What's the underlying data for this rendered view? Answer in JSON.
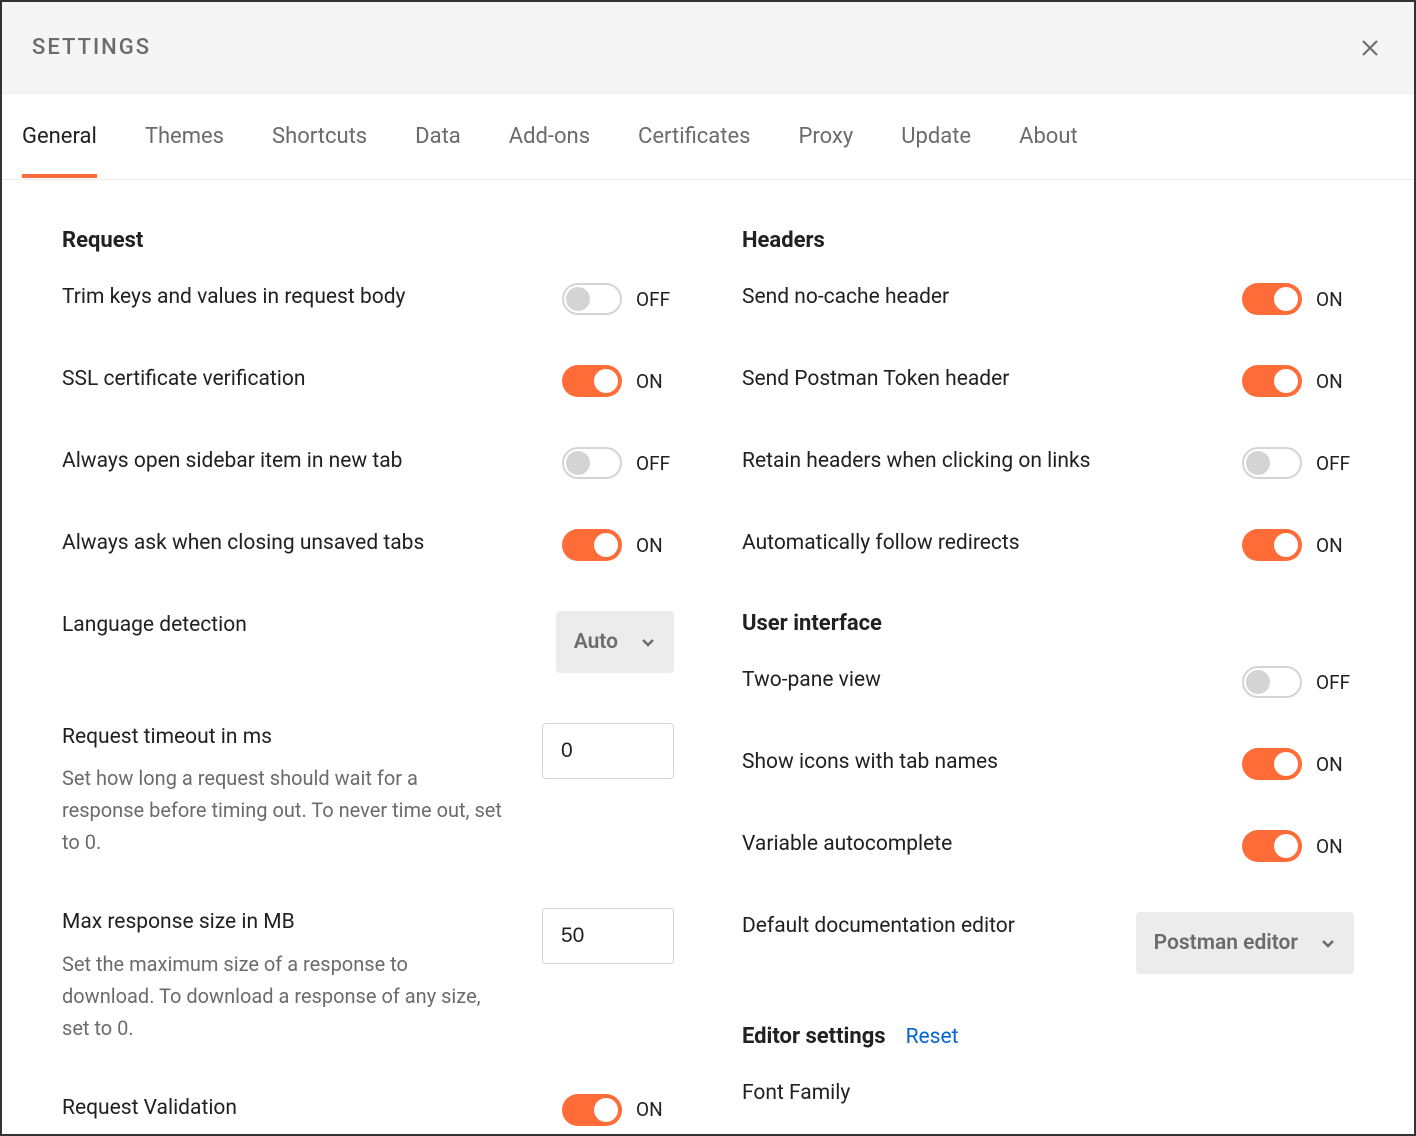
{
  "header": {
    "title": "SETTINGS"
  },
  "tabs": [
    {
      "label": "General",
      "active": true
    },
    {
      "label": "Themes",
      "active": false
    },
    {
      "label": "Shortcuts",
      "active": false
    },
    {
      "label": "Data",
      "active": false
    },
    {
      "label": "Add-ons",
      "active": false
    },
    {
      "label": "Certificates",
      "active": false
    },
    {
      "label": "Proxy",
      "active": false
    },
    {
      "label": "Update",
      "active": false
    },
    {
      "label": "About",
      "active": false
    }
  ],
  "labels": {
    "on": "ON",
    "off": "OFF"
  },
  "left": {
    "section_request": "Request",
    "trim": {
      "label": "Trim keys and values in request body",
      "on": false
    },
    "ssl": {
      "label": "SSL certificate verification",
      "on": true
    },
    "sidebar_new_tab": {
      "label": "Always open sidebar item in new tab",
      "on": false
    },
    "ask_unsaved": {
      "label": "Always ask when closing unsaved tabs",
      "on": true
    },
    "lang_detect": {
      "label": "Language detection",
      "value": "Auto"
    },
    "timeout": {
      "label": "Request timeout in ms",
      "desc": "Set how long a request should wait for a response before timing out. To never time out, set to 0.",
      "value": "0"
    },
    "max_size": {
      "label": "Max response size in MB",
      "desc": "Set the maximum size of a response to download. To download a response of any size, set to 0.",
      "value": "50"
    },
    "validation": {
      "label": "Request Validation",
      "on": true
    }
  },
  "right": {
    "section_headers": "Headers",
    "no_cache": {
      "label": "Send no-cache header",
      "on": true
    },
    "token": {
      "label": "Send Postman Token header",
      "on": true
    },
    "retain": {
      "label": "Retain headers when clicking on links",
      "on": false
    },
    "redirects": {
      "label": "Automatically follow redirects",
      "on": true
    },
    "section_ui": "User interface",
    "two_pane": {
      "label": "Two-pane view",
      "on": false
    },
    "icons_tab": {
      "label": "Show icons with tab names",
      "on": true
    },
    "autocomplete": {
      "label": "Variable autocomplete",
      "on": true
    },
    "doc_editor": {
      "label": "Default documentation editor",
      "value": "Postman editor"
    },
    "section_editor": "Editor settings",
    "reset": "Reset",
    "font_family": {
      "label": "Font Family"
    }
  }
}
